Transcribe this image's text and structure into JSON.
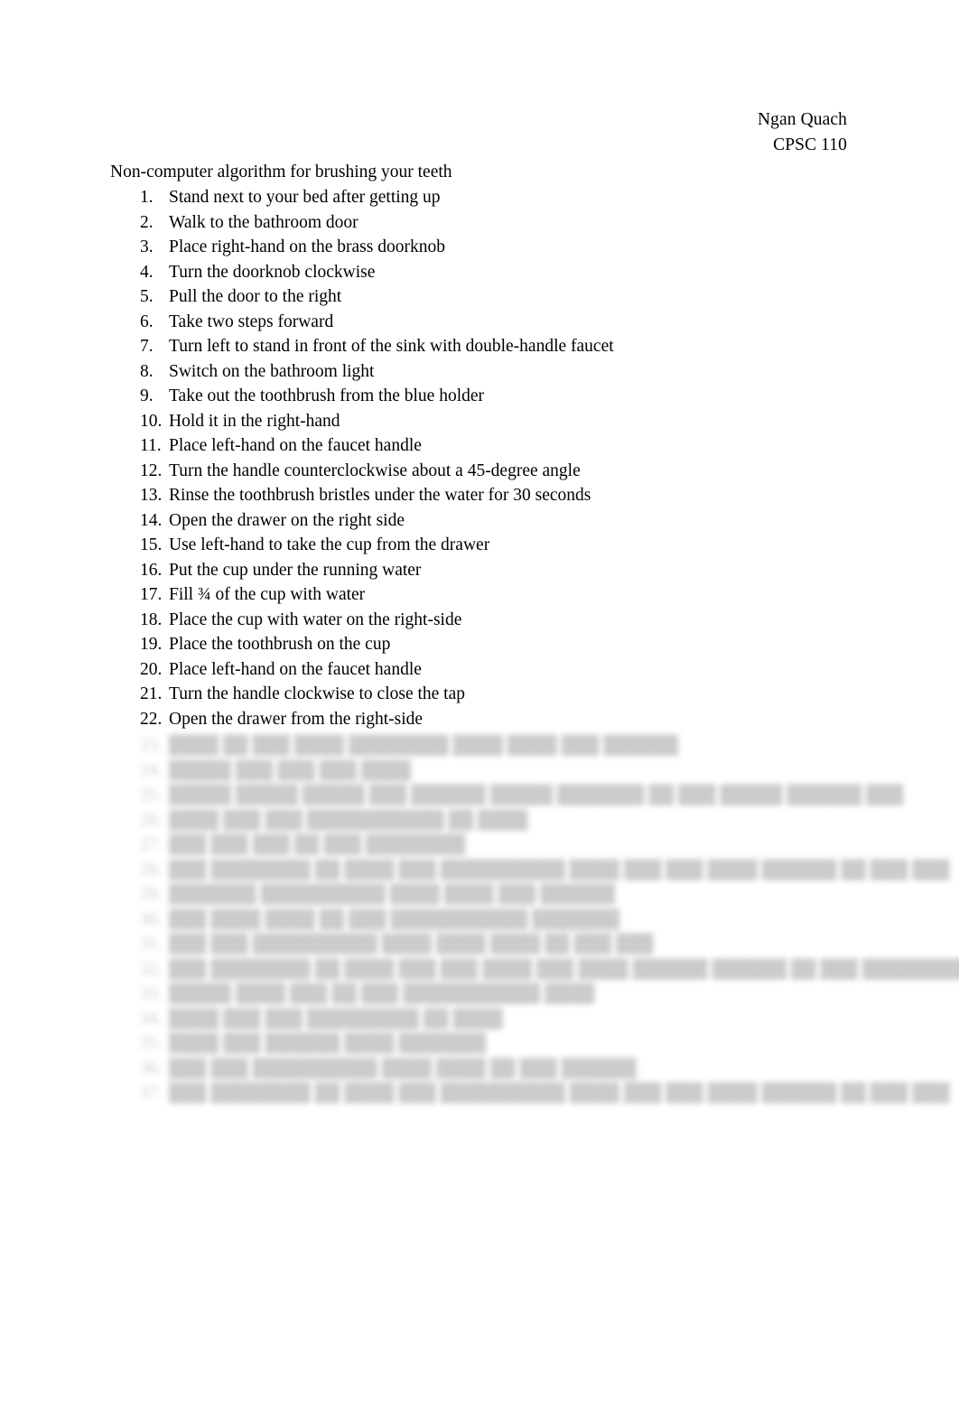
{
  "document": {
    "background_color": "#ffffff",
    "text_color": "#000000"
  },
  "header": {
    "author": "Ngan Quach",
    "course": "CPSC 110"
  },
  "title": "Non-computer algorithm for brushing your teeth",
  "steps": [
    {
      "number": "1.",
      "text": "Stand next to your bed after getting up"
    },
    {
      "number": "2.",
      "text": "Walk to the bathroom door"
    },
    {
      "number": "3.",
      "text": "Place right-hand on the brass doorknob"
    },
    {
      "number": "4.",
      "text": "Turn the doorknob clockwise"
    },
    {
      "number": "5.",
      "text": "Pull the door to the right"
    },
    {
      "number": "6.",
      "text": "Take two steps forward"
    },
    {
      "number": "7.",
      "text": "Turn left to stand in front of the sink with double-handle faucet"
    },
    {
      "number": "8.",
      "text": "Switch on the bathroom light"
    },
    {
      "number": "9.",
      "text": "Take out the toothbrush from the blue holder"
    },
    {
      "number": "10.",
      "text": "Hold it in the right-hand"
    },
    {
      "number": "11.",
      "text": "Place left-hand on the faucet handle"
    },
    {
      "number": "12.",
      "text": "Turn the handle counterclockwise about a 45-degree angle"
    },
    {
      "number": "13.",
      "text": "Rinse the toothbrush bristles under the water for 30 seconds"
    },
    {
      "number": "14.",
      "text": "Open the drawer on the right side"
    },
    {
      "number": "15.",
      "text": "Use left-hand to take the cup from the drawer"
    },
    {
      "number": "16.",
      "text": "Put the cup under the running water"
    },
    {
      "number": "17.",
      "text": "Fill ¾ of the cup with water"
    },
    {
      "number": "18.",
      "text": "Place the cup with water on the right-side"
    },
    {
      "number": "19.",
      "text": "Place the toothbrush on the cup"
    },
    {
      "number": "20.",
      "text": "Place left-hand on the faucet handle"
    },
    {
      "number": "21.",
      "text": "Turn the handle clockwise to close the tap"
    },
    {
      "number": "22.",
      "text": "Open the drawer from the right-side"
    }
  ],
  "faded_steps": [
    {
      "number": "23.",
      "text": "████ ██ ███ ████ ████████ ████ ████ ███ ██████"
    },
    {
      "number": "24.",
      "text": "█████ ███ ███ ███ ████"
    },
    {
      "number": "25.",
      "text": "█████ █████ █████ ███ ██████ █████ ███████ ██ ███ █████ ██████ ███"
    },
    {
      "number": "26.",
      "text": "████ ███ ███ ███████████ ██ ████"
    },
    {
      "number": "27.",
      "text": "███ ███ ███ ██ ███ ████████"
    },
    {
      "number": "28.",
      "text": "███ ████████ ██ ████ ███ ██████████ ████ ███ ███ ████ ██████ ██ ███ ███"
    },
    {
      "number": "29.",
      "text": "███████ ██████████ ████ ████ ███ ██████"
    },
    {
      "number": "30.",
      "text": "███ ████ ████ ██ ███ ███████████ ███████"
    },
    {
      "number": "31.",
      "text": "███ ███ ██████████ ████ ████ ████ ██ ███ ███"
    },
    {
      "number": "32.",
      "text": "███ ████████ ██ ████ ███ ███ ████ ███ ████ ██████ ██████ ██ ███ ██████████"
    },
    {
      "number": "33.",
      "text": "█████ ████ ███ ██ ███ ███████████ ████"
    },
    {
      "number": "34.",
      "text": "████ ███ ███ █████████ ██ ████"
    },
    {
      "number": "35.",
      "text": "████ ███ ██████ ████ ███████"
    },
    {
      "number": "36.",
      "text": "███ ███ ██████████ ████ ████ ██ ███ ██████"
    },
    {
      "number": "37.",
      "text": "███ ████████ ██ ████ ███ ██████████ ████ ███ ███ ████ ██████ ██ ███ ███"
    }
  ]
}
